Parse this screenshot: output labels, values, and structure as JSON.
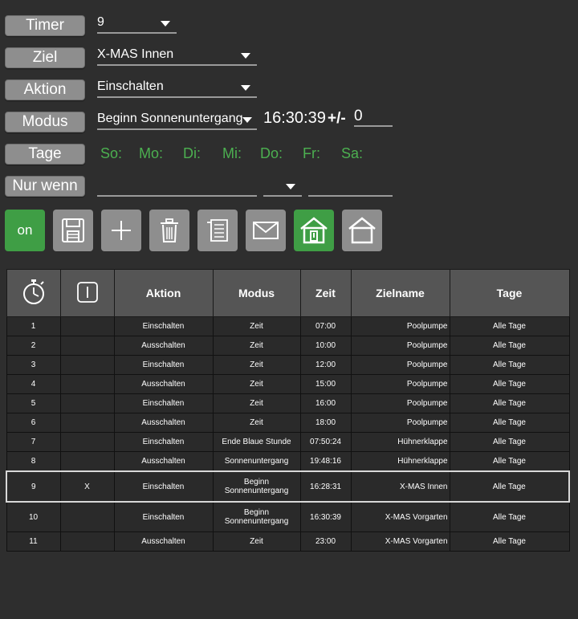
{
  "form": {
    "timer": {
      "label": "Timer",
      "value": "9"
    },
    "ziel": {
      "label": "Ziel",
      "value": "X-MAS Innen"
    },
    "aktion": {
      "label": "Aktion",
      "value": "Einschalten"
    },
    "modus": {
      "label": "Modus",
      "value": "Beginn Sonnenuntergang",
      "time": "16:30:39",
      "offset_label": "+/-",
      "offset_value": "0"
    },
    "tage": {
      "label": "Tage",
      "days": [
        "So:",
        "Mo:",
        "Di:",
        "Mi:",
        "Do:",
        "Fr:",
        "Sa:"
      ]
    },
    "nurwenn": {
      "label": "Nur wenn",
      "value": "",
      "op": "",
      "cmp": ""
    }
  },
  "toolbar": {
    "on_label": "on",
    "icons": [
      "save-icon",
      "plus-icon",
      "trash-icon",
      "list-icon",
      "mail-icon",
      "house-active-icon",
      "house-icon"
    ],
    "accent": "#3f9e45"
  },
  "table": {
    "headers": {
      "timer": "stopwatch-icon",
      "active": "toggle-icon",
      "aktion": "Aktion",
      "modus": "Modus",
      "zeit": "Zeit",
      "zielname": "Zielname",
      "tage": "Tage"
    },
    "rows": [
      {
        "nr": "1",
        "active": "",
        "aktion": "Einschalten",
        "modus": "Zeit",
        "zeit": "07:00",
        "ziel": "Poolpumpe",
        "tage": "Alle Tage"
      },
      {
        "nr": "2",
        "active": "",
        "aktion": "Ausschalten",
        "modus": "Zeit",
        "zeit": "10:00",
        "ziel": "Poolpumpe",
        "tage": "Alle Tage"
      },
      {
        "nr": "3",
        "active": "",
        "aktion": "Einschalten",
        "modus": "Zeit",
        "zeit": "12:00",
        "ziel": "Poolpumpe",
        "tage": "Alle Tage"
      },
      {
        "nr": "4",
        "active": "",
        "aktion": "Ausschalten",
        "modus": "Zeit",
        "zeit": "15:00",
        "ziel": "Poolpumpe",
        "tage": "Alle Tage"
      },
      {
        "nr": "5",
        "active": "",
        "aktion": "Einschalten",
        "modus": "Zeit",
        "zeit": "16:00",
        "ziel": "Poolpumpe",
        "tage": "Alle Tage"
      },
      {
        "nr": "6",
        "active": "",
        "aktion": "Ausschalten",
        "modus": "Zeit",
        "zeit": "18:00",
        "ziel": "Poolpumpe",
        "tage": "Alle Tage"
      },
      {
        "nr": "7",
        "active": "",
        "aktion": "Einschalten",
        "modus": "Ende Blaue Stunde",
        "zeit": "07:50:24",
        "ziel": "Hühnerklappe",
        "tage": "Alle Tage"
      },
      {
        "nr": "8",
        "active": "",
        "aktion": "Ausschalten",
        "modus": "Sonnenuntergang",
        "zeit": "19:48:16",
        "ziel": "Hühnerklappe",
        "tage": "Alle Tage"
      },
      {
        "nr": "9",
        "active": "X",
        "aktion": "Einschalten",
        "modus": "Beginn Sonnenuntergang",
        "zeit": "16:28:31",
        "ziel": "X-MAS Innen",
        "tage": "Alle Tage"
      },
      {
        "nr": "10",
        "active": "",
        "aktion": "Einschalten",
        "modus": "Beginn Sonnenuntergang",
        "zeit": "16:30:39",
        "ziel": "X-MAS Vorgarten",
        "tage": "Alle Tage"
      },
      {
        "nr": "11",
        "active": "",
        "aktion": "Ausschalten",
        "modus": "Zeit",
        "zeit": "23:00",
        "ziel": "X-MAS Vorgarten",
        "tage": "Alle Tage"
      }
    ]
  }
}
